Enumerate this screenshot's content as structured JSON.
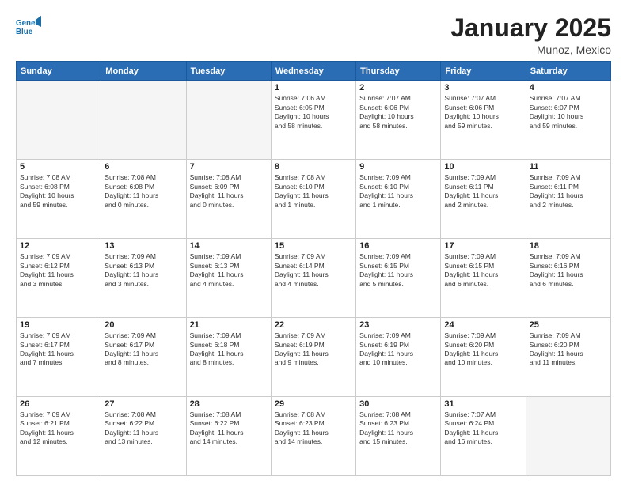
{
  "header": {
    "logo_line1": "General",
    "logo_line2": "Blue",
    "title": "January 2025",
    "subtitle": "Munoz, Mexico"
  },
  "weekdays": [
    "Sunday",
    "Monday",
    "Tuesday",
    "Wednesday",
    "Thursday",
    "Friday",
    "Saturday"
  ],
  "weeks": [
    [
      {
        "day": "",
        "info": "",
        "empty": true
      },
      {
        "day": "",
        "info": "",
        "empty": true
      },
      {
        "day": "",
        "info": "",
        "empty": true
      },
      {
        "day": "1",
        "info": "Sunrise: 7:06 AM\nSunset: 6:05 PM\nDaylight: 10 hours\nand 58 minutes."
      },
      {
        "day": "2",
        "info": "Sunrise: 7:07 AM\nSunset: 6:06 PM\nDaylight: 10 hours\nand 58 minutes."
      },
      {
        "day": "3",
        "info": "Sunrise: 7:07 AM\nSunset: 6:06 PM\nDaylight: 10 hours\nand 59 minutes."
      },
      {
        "day": "4",
        "info": "Sunrise: 7:07 AM\nSunset: 6:07 PM\nDaylight: 10 hours\nand 59 minutes."
      }
    ],
    [
      {
        "day": "5",
        "info": "Sunrise: 7:08 AM\nSunset: 6:08 PM\nDaylight: 10 hours\nand 59 minutes."
      },
      {
        "day": "6",
        "info": "Sunrise: 7:08 AM\nSunset: 6:08 PM\nDaylight: 11 hours\nand 0 minutes."
      },
      {
        "day": "7",
        "info": "Sunrise: 7:08 AM\nSunset: 6:09 PM\nDaylight: 11 hours\nand 0 minutes."
      },
      {
        "day": "8",
        "info": "Sunrise: 7:08 AM\nSunset: 6:10 PM\nDaylight: 11 hours\nand 1 minute."
      },
      {
        "day": "9",
        "info": "Sunrise: 7:09 AM\nSunset: 6:10 PM\nDaylight: 11 hours\nand 1 minute."
      },
      {
        "day": "10",
        "info": "Sunrise: 7:09 AM\nSunset: 6:11 PM\nDaylight: 11 hours\nand 2 minutes."
      },
      {
        "day": "11",
        "info": "Sunrise: 7:09 AM\nSunset: 6:11 PM\nDaylight: 11 hours\nand 2 minutes."
      }
    ],
    [
      {
        "day": "12",
        "info": "Sunrise: 7:09 AM\nSunset: 6:12 PM\nDaylight: 11 hours\nand 3 minutes."
      },
      {
        "day": "13",
        "info": "Sunrise: 7:09 AM\nSunset: 6:13 PM\nDaylight: 11 hours\nand 3 minutes."
      },
      {
        "day": "14",
        "info": "Sunrise: 7:09 AM\nSunset: 6:13 PM\nDaylight: 11 hours\nand 4 minutes."
      },
      {
        "day": "15",
        "info": "Sunrise: 7:09 AM\nSunset: 6:14 PM\nDaylight: 11 hours\nand 4 minutes."
      },
      {
        "day": "16",
        "info": "Sunrise: 7:09 AM\nSunset: 6:15 PM\nDaylight: 11 hours\nand 5 minutes."
      },
      {
        "day": "17",
        "info": "Sunrise: 7:09 AM\nSunset: 6:15 PM\nDaylight: 11 hours\nand 6 minutes."
      },
      {
        "day": "18",
        "info": "Sunrise: 7:09 AM\nSunset: 6:16 PM\nDaylight: 11 hours\nand 6 minutes."
      }
    ],
    [
      {
        "day": "19",
        "info": "Sunrise: 7:09 AM\nSunset: 6:17 PM\nDaylight: 11 hours\nand 7 minutes."
      },
      {
        "day": "20",
        "info": "Sunrise: 7:09 AM\nSunset: 6:17 PM\nDaylight: 11 hours\nand 8 minutes."
      },
      {
        "day": "21",
        "info": "Sunrise: 7:09 AM\nSunset: 6:18 PM\nDaylight: 11 hours\nand 8 minutes."
      },
      {
        "day": "22",
        "info": "Sunrise: 7:09 AM\nSunset: 6:19 PM\nDaylight: 11 hours\nand 9 minutes."
      },
      {
        "day": "23",
        "info": "Sunrise: 7:09 AM\nSunset: 6:19 PM\nDaylight: 11 hours\nand 10 minutes."
      },
      {
        "day": "24",
        "info": "Sunrise: 7:09 AM\nSunset: 6:20 PM\nDaylight: 11 hours\nand 10 minutes."
      },
      {
        "day": "25",
        "info": "Sunrise: 7:09 AM\nSunset: 6:20 PM\nDaylight: 11 hours\nand 11 minutes."
      }
    ],
    [
      {
        "day": "26",
        "info": "Sunrise: 7:09 AM\nSunset: 6:21 PM\nDaylight: 11 hours\nand 12 minutes."
      },
      {
        "day": "27",
        "info": "Sunrise: 7:08 AM\nSunset: 6:22 PM\nDaylight: 11 hours\nand 13 minutes."
      },
      {
        "day": "28",
        "info": "Sunrise: 7:08 AM\nSunset: 6:22 PM\nDaylight: 11 hours\nand 14 minutes."
      },
      {
        "day": "29",
        "info": "Sunrise: 7:08 AM\nSunset: 6:23 PM\nDaylight: 11 hours\nand 14 minutes."
      },
      {
        "day": "30",
        "info": "Sunrise: 7:08 AM\nSunset: 6:23 PM\nDaylight: 11 hours\nand 15 minutes."
      },
      {
        "day": "31",
        "info": "Sunrise: 7:07 AM\nSunset: 6:24 PM\nDaylight: 11 hours\nand 16 minutes."
      },
      {
        "day": "",
        "info": "",
        "empty": true,
        "shaded": true
      }
    ]
  ]
}
